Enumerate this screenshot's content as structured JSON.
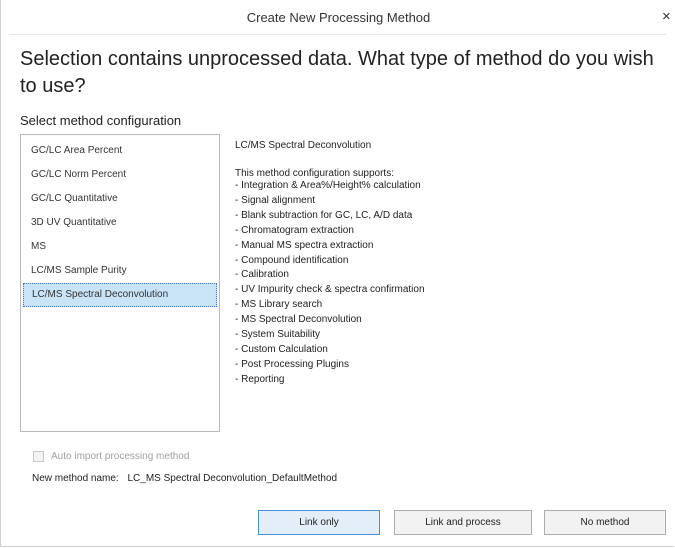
{
  "window": {
    "title": "Create New Processing Method",
    "close_glyph": "×"
  },
  "heading": "Selection contains unprocessed data. What type of method do you wish to use?",
  "config_section_label": "Select method configuration",
  "configurations": [
    "GC/LC Area Percent",
    "GC/LC Norm Percent",
    "GC/LC Quantitative",
    "3D UV Quantitative",
    "MS",
    "LC/MS Sample Purity",
    "LC/MS Spectral Deconvolution"
  ],
  "selected_configuration": "LC/MS Spectral Deconvolution",
  "description": {
    "title": "LC/MS Spectral Deconvolution",
    "intro": "This method configuration supports:",
    "features": [
      "- Integration & Area%/Height% calculation",
      "- Signal alignment",
      "- Blank subtraction for GC, LC, A/D data",
      "- Chromatogram extraction",
      "- Manual MS spectra extraction",
      "- Compound identification",
      "- Calibration",
      "- UV Impurity check & spectra confirmation",
      "- MS Library search",
      "- MS Spectral Deconvolution",
      "- System Suitability",
      "- Custom Calculation",
      "- Post Processing Plugins",
      "- Reporting"
    ]
  },
  "auto_import": {
    "label": "Auto import processing method",
    "checked": false,
    "enabled": false
  },
  "method_name": {
    "label": "New method name:",
    "value": "LC_MS Spectral Deconvolution_DefaultMethod"
  },
  "buttons": {
    "link_only": "Link only",
    "link_and_process": "Link and process",
    "no_method": "No method"
  }
}
